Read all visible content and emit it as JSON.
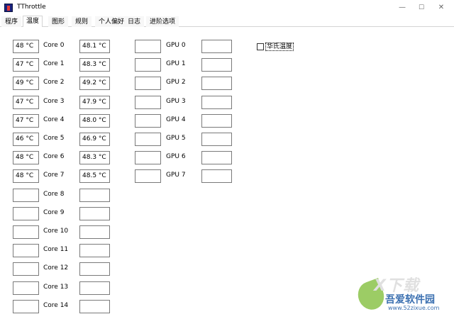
{
  "window": {
    "title": "TThrottle",
    "minimize": "—",
    "maximize": "☐",
    "close": "✕"
  },
  "tabs": [
    "程序",
    "温度",
    "图形",
    "规则",
    "个人偏好",
    "日志",
    "进阶选项"
  ],
  "active_tab": "温度",
  "cores": [
    {
      "temp": "48 °C",
      "label": "Core 0",
      "temp2": "48.1 °C"
    },
    {
      "temp": "47 °C",
      "label": "Core 1",
      "temp2": "48.3 °C"
    },
    {
      "temp": "49 °C",
      "label": "Core 2",
      "temp2": "49.2 °C"
    },
    {
      "temp": "47 °C",
      "label": "Core 3",
      "temp2": "47.9 °C"
    },
    {
      "temp": "47 °C",
      "label": "Core 4",
      "temp2": "48.0 °C"
    },
    {
      "temp": "46 °C",
      "label": "Core 5",
      "temp2": "46.9 °C"
    },
    {
      "temp": "48 °C",
      "label": "Core 6",
      "temp2": "48.3 °C"
    },
    {
      "temp": "48 °C",
      "label": "Core 7",
      "temp2": "48.5 °C"
    },
    {
      "temp": "",
      "label": "Core 8",
      "temp2": ""
    },
    {
      "temp": "",
      "label": "Core 9",
      "temp2": ""
    },
    {
      "temp": "",
      "label": "Core 10",
      "temp2": ""
    },
    {
      "temp": "",
      "label": "Core 11",
      "temp2": ""
    },
    {
      "temp": "",
      "label": "Core 12",
      "temp2": ""
    },
    {
      "temp": "",
      "label": "Core 13",
      "temp2": ""
    },
    {
      "temp": "",
      "label": "Core 14",
      "temp2": ""
    }
  ],
  "gpus": [
    {
      "temp": "",
      "label": "GPU 0",
      "temp2": ""
    },
    {
      "temp": "",
      "label": "GPU 1",
      "temp2": ""
    },
    {
      "temp": "",
      "label": "GPU 2",
      "temp2": ""
    },
    {
      "temp": "",
      "label": "GPU 3",
      "temp2": ""
    },
    {
      "temp": "",
      "label": "GPU 4",
      "temp2": ""
    },
    {
      "temp": "",
      "label": "GPU 5",
      "temp2": ""
    },
    {
      "temp": "",
      "label": "GPU 6",
      "temp2": ""
    },
    {
      "temp": "",
      "label": "GPU 7",
      "temp2": ""
    }
  ],
  "fahrenheit": {
    "label": "华氏温度",
    "checked": false
  },
  "watermark": {
    "top": "X下载",
    "main": "吾爱软件园",
    "url": "www.52zixue.com"
  }
}
